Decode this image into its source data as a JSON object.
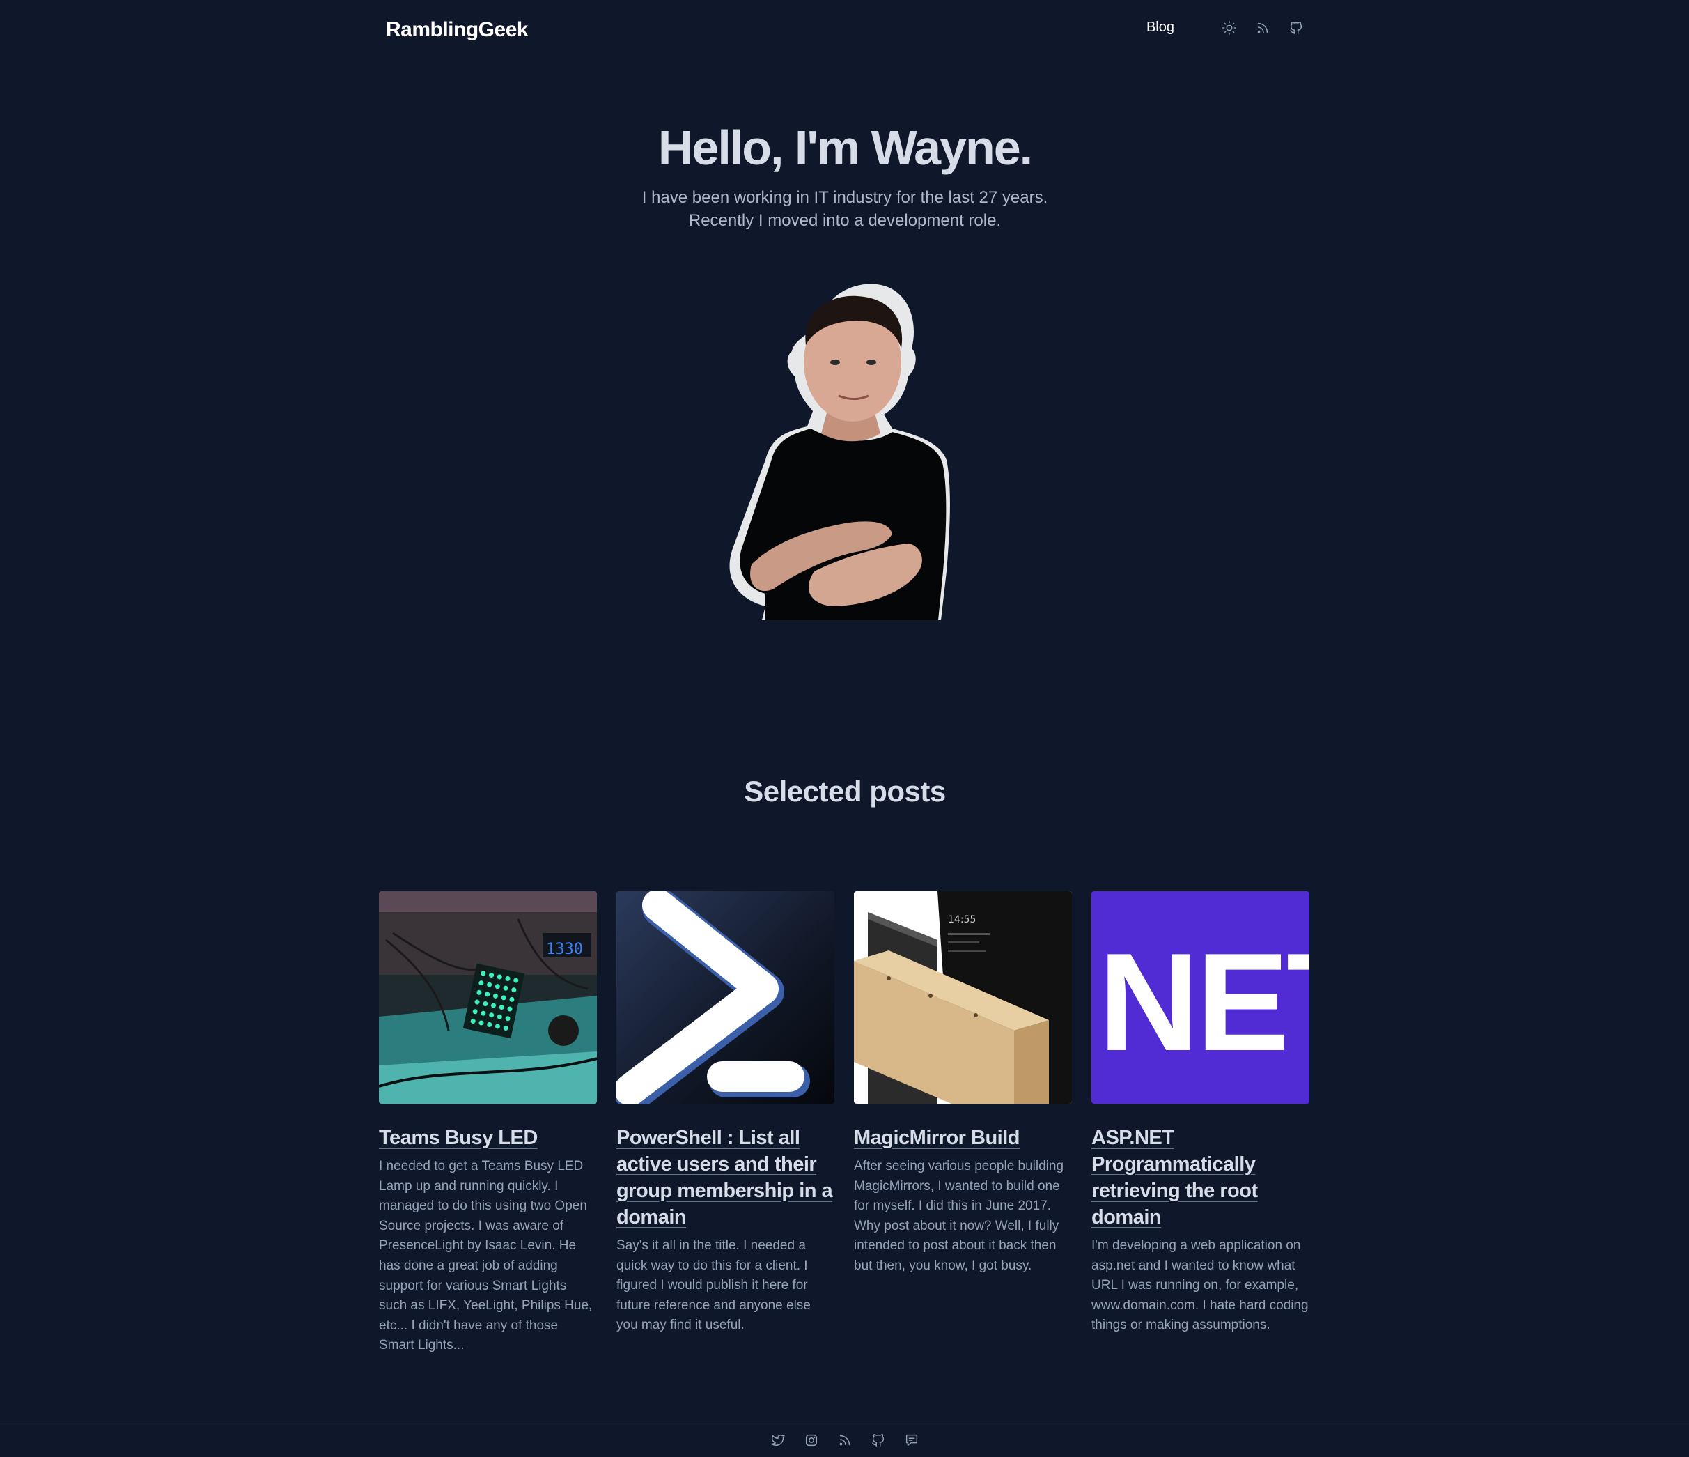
{
  "header": {
    "brand": "RamblingGeek",
    "nav_blog": "Blog",
    "icons": [
      "sun-icon",
      "rss-icon",
      "github-icon"
    ]
  },
  "hero": {
    "title": "Hello, I'm Wayne.",
    "line1": "I have been working in IT industry for the last 27 years.",
    "line2": "Recently I moved into a development role."
  },
  "section": {
    "title": "Selected posts"
  },
  "posts": [
    {
      "title": "Teams Busy LED",
      "excerpt": "I needed to get a Teams Busy LED Lamp up and running quickly. I managed to do this using two Open Source projects. I was aware of PresenceLight by Isaac Levin. He has done a great job of adding support for various Smart Lights such as LIFX, YeeLight, Philips Hue, etc... I didn't have any of those Smart Lights..."
    },
    {
      "title": "PowerShell : List all active users and their group membership in a domain",
      "excerpt": "Say's it all in the title. I needed a quick way to do this for a client. I figured I would publish it here for future reference and anyone else you may find it useful."
    },
    {
      "title": "MagicMirror Build",
      "excerpt": "After seeing various people building MagicMirrors, I wanted to build one for myself.  I did this in June 2017. Why post about it now? Well, I fully intended to post about it back then but then, you know, I got busy.",
      "thumb_time": "14:55"
    },
    {
      "title": "ASP.NET Programmatically retrieving the root domain",
      "excerpt": "I'm developing a web application on asp.net and I wanted to know what URL I was running on, for example, www.domain.com. I hate hard coding things or making assumptions.",
      "thumb_text": "NET"
    }
  ],
  "footer": {
    "icons": [
      "twitter-icon",
      "instagram-icon",
      "rss-icon",
      "github-icon",
      "comment-icon"
    ]
  },
  "colors": {
    "background": "#0f172a",
    "heading": "#d6dde8",
    "muted": "#94a3b8",
    "dotnet_purple": "#512bd4"
  }
}
